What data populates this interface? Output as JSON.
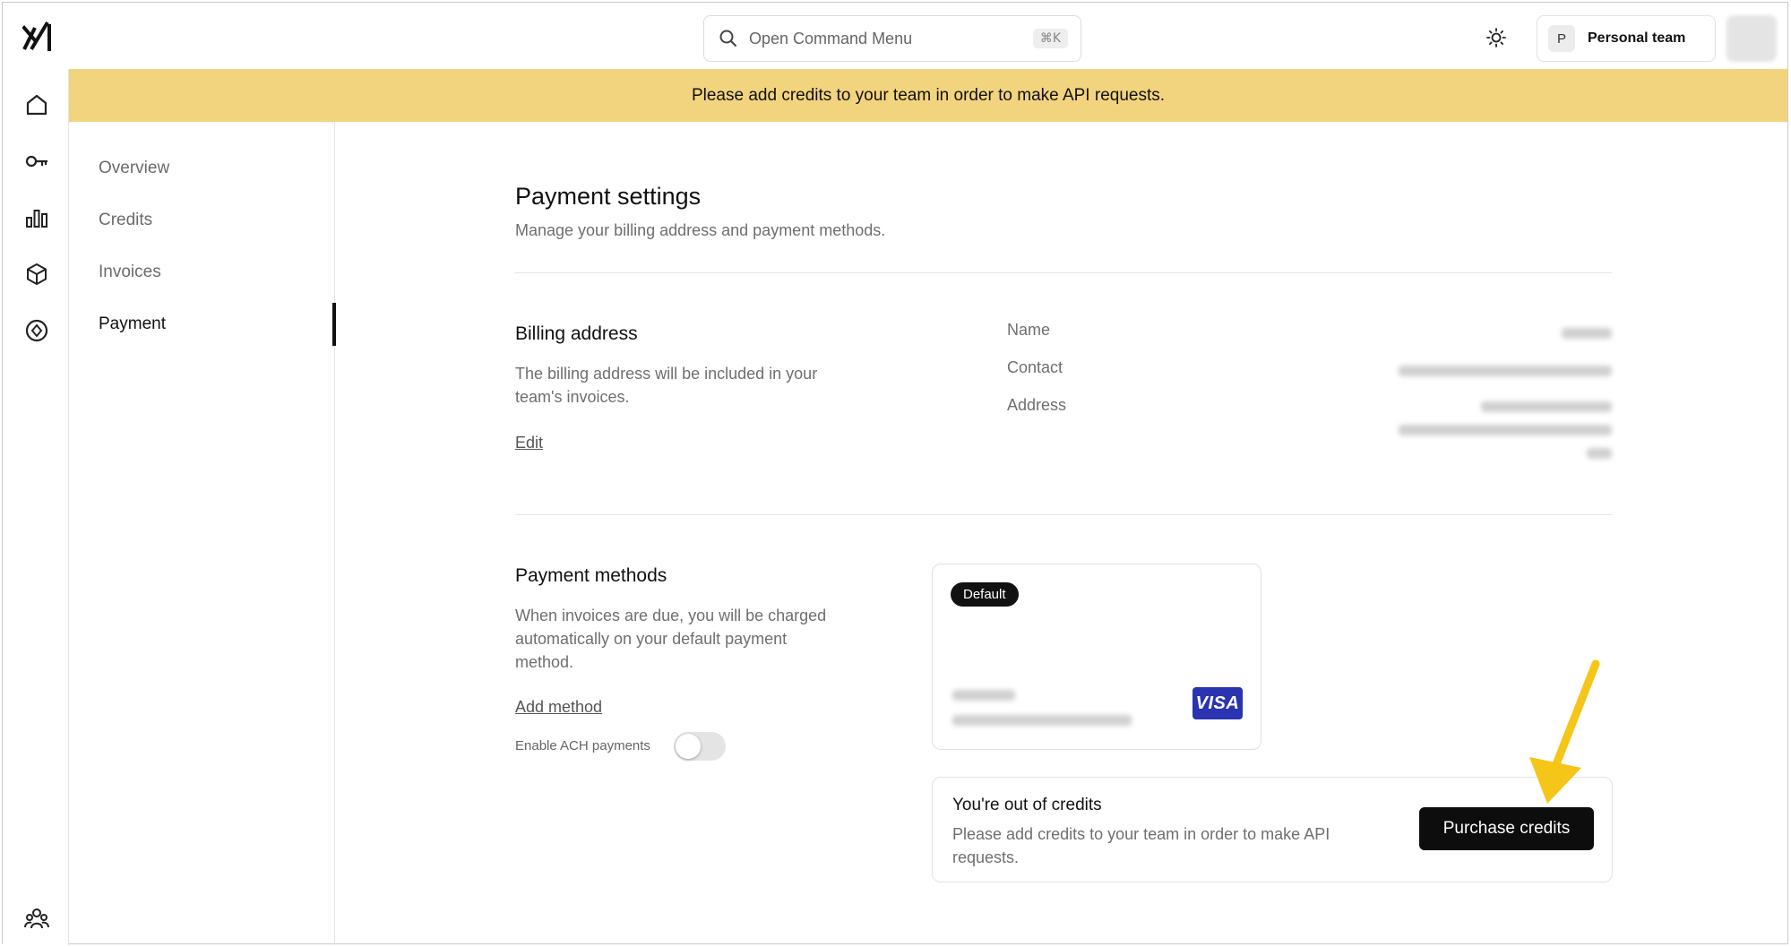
{
  "topbar": {
    "logo_icon": "xai-logo",
    "search_placeholder": "Open Command Menu",
    "search_shortcut": "⌘K",
    "theme_icon": "sun-icon",
    "team_initial": "P",
    "team_name": "Personal team"
  },
  "banner": {
    "text": "Please add credits to your team in order to make API requests.",
    "color": "#f3d47e"
  },
  "rail": {
    "items": [
      "home-icon",
      "key-icon",
      "bar-chart-icon",
      "cube-icon",
      "compass-icon"
    ],
    "bottom": "team-icon"
  },
  "subnav": {
    "items": [
      {
        "label": "Overview"
      },
      {
        "label": "Credits"
      },
      {
        "label": "Invoices"
      },
      {
        "label": "Payment"
      }
    ],
    "active": "Payment"
  },
  "main": {
    "title": "Payment settings",
    "subtitle": "Manage your billing address and payment methods.",
    "billing": {
      "title": "Billing address",
      "description": "The billing address will be included in your team's invoices.",
      "edit_label": "Edit",
      "fields": [
        {
          "label": "Name"
        },
        {
          "label": "Contact"
        },
        {
          "label": "Address"
        }
      ]
    },
    "payment_methods": {
      "title": "Payment methods",
      "description": "When invoices are due, you will be charged automatically on your default payment method.",
      "add_label": "Add method",
      "ach_label": "Enable ACH payments",
      "ach_enabled": false,
      "card": {
        "badge": "Default",
        "brand": "VISA",
        "brand_color": "#2a33b0"
      }
    },
    "credits_alert": {
      "title": "You're out of credits",
      "description": "Please add credits to your team in order to make API requests.",
      "button": "Purchase credits"
    }
  },
  "annotation": {
    "arrow_color": "#f5c518"
  }
}
